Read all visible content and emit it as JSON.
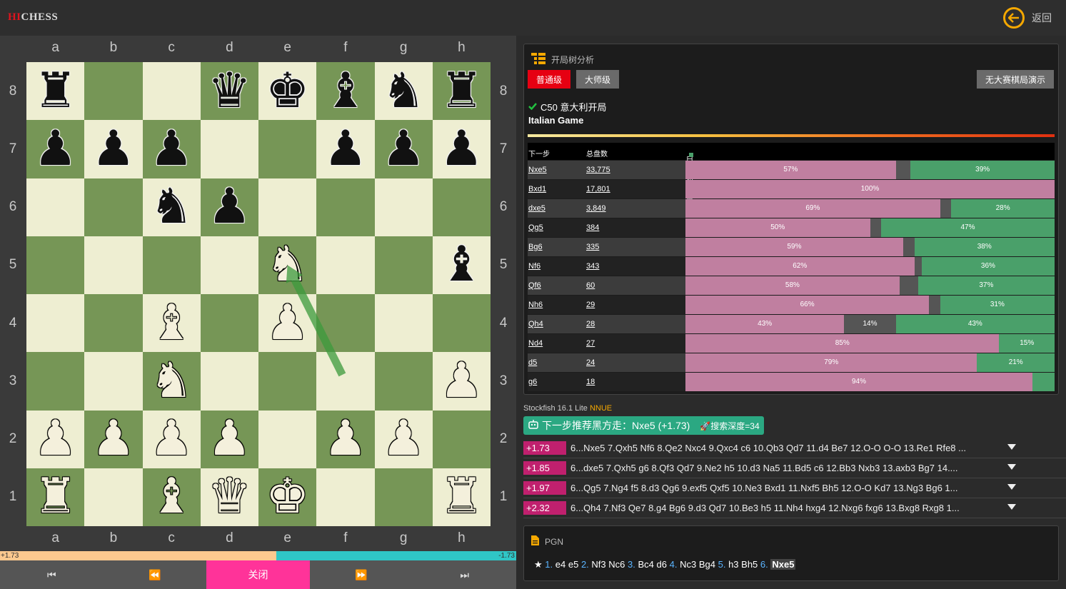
{
  "header": {
    "logo_hi": "HI",
    "logo_chess": "CHESS",
    "back_label": "返回"
  },
  "board": {
    "files": [
      "a",
      "b",
      "c",
      "d",
      "e",
      "f",
      "g",
      "h"
    ],
    "ranks": [
      "8",
      "7",
      "6",
      "5",
      "4",
      "3",
      "2",
      "1"
    ],
    "position": [
      [
        "r",
        "",
        "",
        "q",
        "k",
        "b",
        "n",
        "r"
      ],
      [
        "p",
        "p",
        "p",
        "",
        "",
        "p",
        "p",
        "p"
      ],
      [
        "",
        "",
        "n",
        "p",
        "",
        "",
        "",
        ""
      ],
      [
        "",
        "",
        "",
        "",
        "N",
        "",
        "",
        "b"
      ],
      [
        "",
        "",
        "B",
        "",
        "P",
        "",
        "",
        ""
      ],
      [
        "",
        "",
        "N",
        "",
        "",
        "",
        "",
        "P"
      ],
      [
        "P",
        "P",
        "P",
        "P",
        "",
        "P",
        "P",
        ""
      ],
      [
        "R",
        "",
        "B",
        "Q",
        "K",
        "",
        "",
        "R"
      ]
    ],
    "arrow": {
      "from": "f3",
      "to": "e5",
      "color": "#3c9a3c"
    }
  },
  "eval_bar": {
    "white_fraction": 0.535,
    "white_label": "+1.73",
    "black_label": "-1.73"
  },
  "controls": {
    "first": "⏮",
    "prev": "⏪",
    "close": "关闭",
    "next": "⏩",
    "last": "⏭"
  },
  "opening_panel": {
    "title": "开局树分析",
    "btn_normal": "普通级",
    "btn_master": "大师级",
    "btn_demo": "无大赛棋局演示",
    "eco": "C50 意大利开局",
    "name": "Italian Game",
    "col_move": "下一步",
    "col_games": "总盘数",
    "col_ratio": "白胜/和棋/黑胜比率",
    "legend_colors": [
      "#c07fa0",
      "#666666",
      "#4aa06a"
    ],
    "rows": [
      {
        "move": "Nxe5",
        "games": "33,775",
        "w": 57,
        "d": 4,
        "b": 39,
        "wl": "57%",
        "dl": "",
        "bl": "39%"
      },
      {
        "move": "Bxd1",
        "games": "17,801",
        "w": 100,
        "d": 0,
        "b": 0,
        "wl": "100%",
        "dl": "",
        "bl": ""
      },
      {
        "move": "dxe5",
        "games": "3,849",
        "w": 69,
        "d": 3,
        "b": 28,
        "wl": "69%",
        "dl": "",
        "bl": "28%"
      },
      {
        "move": "Qg5",
        "games": "384",
        "w": 50,
        "d": 3,
        "b": 47,
        "wl": "50%",
        "dl": "",
        "bl": "47%"
      },
      {
        "move": "Bg6",
        "games": "335",
        "w": 59,
        "d": 3,
        "b": 38,
        "wl": "59%",
        "dl": "",
        "bl": "38%"
      },
      {
        "move": "Nf6",
        "games": "343",
        "w": 62,
        "d": 2,
        "b": 36,
        "wl": "62%",
        "dl": "",
        "bl": "36%"
      },
      {
        "move": "Qf6",
        "games": "60",
        "w": 58,
        "d": 5,
        "b": 37,
        "wl": "58%",
        "dl": "",
        "bl": "37%"
      },
      {
        "move": "Nh6",
        "games": "29",
        "w": 66,
        "d": 3,
        "b": 31,
        "wl": "66%",
        "dl": "",
        "bl": "31%"
      },
      {
        "move": "Qh4",
        "games": "28",
        "w": 43,
        "d": 14,
        "b": 43,
        "wl": "43%",
        "dl": "14%",
        "bl": "43%"
      },
      {
        "move": "Nd4",
        "games": "27",
        "w": 85,
        "d": 0,
        "b": 15,
        "wl": "85%",
        "dl": "",
        "bl": "15%"
      },
      {
        "move": "d5",
        "games": "24",
        "w": 79,
        "d": 0,
        "b": 21,
        "wl": "79%",
        "dl": "",
        "bl": "21%"
      },
      {
        "move": "g6",
        "games": "18",
        "w": 94,
        "d": 0,
        "b": 6,
        "wl": "94%",
        "dl": "",
        "bl": ""
      }
    ]
  },
  "engine": {
    "name": "Stockfish 16.1 Lite",
    "nnue": "NNUE",
    "recommend": "下一步推荐黑方走：Nxe5 (+1.73)",
    "depth": "搜索深度=34",
    "lines": [
      {
        "score": "+1.73",
        "pv": "6...Nxe5 7.Qxh5 Nf6 8.Qe2 Nxc4 9.Qxc4 c6 10.Qb3 Qd7 11.d4 Be7 12.O-O O-O 13.Re1 Rfe8 ..."
      },
      {
        "score": "+1.85",
        "pv": "6...dxe5 7.Qxh5 g6 8.Qf3 Qd7 9.Ne2 h5 10.d3 Na5 11.Bd5 c6 12.Bb3 Nxb3 13.axb3 Bg7 14...."
      },
      {
        "score": "+1.97",
        "pv": "6...Qg5 7.Ng4 f5 8.d3 Qg6 9.exf5 Qxf5 10.Ne3 Bxd1 11.Nxf5 Bh5 12.O-O Kd7 13.Ng3 Bg6 1..."
      },
      {
        "score": "+2.32",
        "pv": "6...Qh4 7.Nf3 Qe7 8.g4 Bg6 9.d3 Qd7 10.Be3 h5 11.Nh4 hxg4 12.Nxg6 fxg6 13.Bxg8 Rxg8 1..."
      }
    ]
  },
  "pgn": {
    "title": "PGN",
    "star": "★",
    "moves": [
      {
        "n": "1.",
        "w": "e4",
        "b": "e5"
      },
      {
        "n": "2.",
        "w": "Nf3",
        "b": "Nc6"
      },
      {
        "n": "3.",
        "w": "Bc4",
        "b": "d6"
      },
      {
        "n": "4.",
        "w": "Nc3",
        "b": "Bg4"
      },
      {
        "n": "5.",
        "w": "h3",
        "b": "Bh5"
      }
    ],
    "last_num": "6.",
    "current": "Nxe5"
  }
}
